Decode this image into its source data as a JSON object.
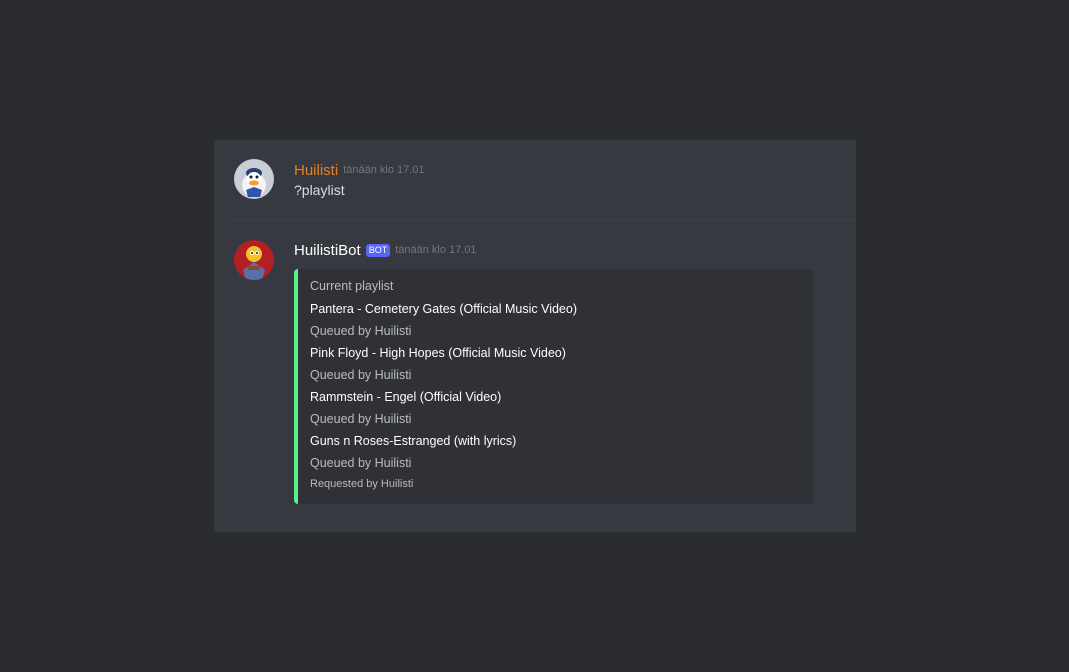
{
  "colors": {
    "background": "#2b2c2f",
    "panel": "#36393f",
    "embed_background": "#2f3136",
    "embed_accent": "#57f287",
    "huilisti_name": "#e67e22",
    "bot_tag": "#5865f2"
  },
  "messages": [
    {
      "avatar_icon": "donald-duck-avatar-icon",
      "username": "Huilisti",
      "timestamp": "tänään klo 17.01",
      "content": "?playlist"
    },
    {
      "avatar_icon": "bot-character-avatar-icon",
      "username": "HuilistiBot",
      "bot_tag": "BOT",
      "timestamp": "tänään klo 17.01",
      "embed": {
        "title": "Current playlist",
        "tracks": [
          {
            "name": "Pantera - Cemetery Gates (Official Music Video)",
            "queued_by": "Queued by Huilisti"
          },
          {
            "name": "Pink Floyd - High Hopes (Official Music Video)",
            "queued_by": "Queued by Huilisti"
          },
          {
            "name": "Rammstein - Engel (Official Video)",
            "queued_by": "Queued by Huilisti"
          },
          {
            "name": "Guns n Roses-Estranged (with lyrics)",
            "queued_by": "Queued by Huilisti"
          }
        ],
        "footer": "Requested by Huilisti"
      }
    }
  ]
}
